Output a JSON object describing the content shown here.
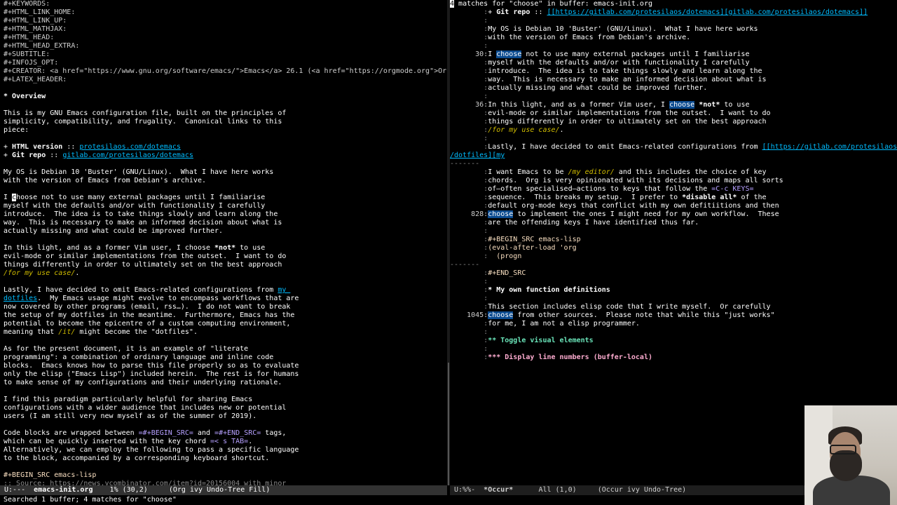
{
  "left": {
    "lines": [
      [
        {
          "t": "#+KEYWORDS:",
          "c": "kw"
        }
      ],
      [
        {
          "t": "#+HTML_LINK_HOME:",
          "c": "kw"
        }
      ],
      [
        {
          "t": "#+HTML_LINK_UP:",
          "c": "kw"
        }
      ],
      [
        {
          "t": "#+HTML_MATHJAX:",
          "c": "kw"
        }
      ],
      [
        {
          "t": "#+HTML_HEAD:",
          "c": "kw"
        }
      ],
      [
        {
          "t": "#+HTML_HEAD_EXTRA:",
          "c": "kw"
        }
      ],
      [
        {
          "t": "#+SUBTITLE:",
          "c": "kw"
        }
      ],
      [
        {
          "t": "#+INFOJS_OPT:",
          "c": "kw"
        }
      ],
      [
        {
          "t": "#+CREATOR: <a href=\"https://www.gnu.org/software/emacs/\">Emacs</a> 26.1 (<a href=\"https://orgmode.org\">Or",
          "c": "kw"
        }
      ],
      [
        {
          "t": "#+LATEX_HEADER:",
          "c": "kw"
        }
      ],
      [],
      [
        {
          "t": "* Overview",
          "c": "heading"
        }
      ],
      [],
      [
        {
          "t": "This is my GNU Emacs configuration file, built on the principles of"
        }
      ],
      [
        {
          "t": "simplicity, compatibility, and frugality.  Canonical links to this"
        }
      ],
      [
        {
          "t": "piece:"
        }
      ],
      [],
      [
        {
          "t": "+ ",
          "c": ""
        },
        {
          "t": "HTML version",
          "c": "heading"
        },
        {
          "t": " :: "
        },
        {
          "t": "protesilaos.com/dotemacs",
          "c": "link"
        }
      ],
      [
        {
          "t": "+ ",
          "c": ""
        },
        {
          "t": "Git repo",
          "c": "heading"
        },
        {
          "t": " :: "
        },
        {
          "t": "gitlab.com/protesilaos/dotemacs",
          "c": "link"
        }
      ],
      [],
      [
        {
          "t": "My OS is Debian 10 'Buster' (GNU/Linux).  What I have here works"
        }
      ],
      [
        {
          "t": "with the version of Emacs from Debian's archive."
        }
      ],
      [],
      [
        {
          "t": "I "
        },
        {
          "t": "c",
          "c": "cursor"
        },
        {
          "t": "hoose not to use many external packages until I familiarise"
        }
      ],
      [
        {
          "t": "myself with the defaults and/or with functionality I carefully"
        }
      ],
      [
        {
          "t": "introduce.  The idea is to take things slowly and learn along the"
        }
      ],
      [
        {
          "t": "way.  This is necessary to make an informed decision about what is"
        }
      ],
      [
        {
          "t": "actually missing and what could be improved further."
        }
      ],
      [],
      [
        {
          "t": "In this light, and as a former Vim user, I choose "
        },
        {
          "t": "*not*",
          "c": "heading"
        },
        {
          "t": " to use"
        }
      ],
      [
        {
          "t": "evil-mode or similar implementations from the outset.  I want to do"
        }
      ],
      [
        {
          "t": "things differently in order to ultimately set on the best approach"
        }
      ],
      [
        {
          "t": "/for my use case/",
          "c": "italic"
        },
        {
          "t": "."
        }
      ],
      [],
      [
        {
          "t": "Lastly, I have decided to omit Emacs-related configurations from "
        },
        {
          "t": "my ",
          "c": "link"
        }
      ],
      [
        {
          "t": "dotfiles",
          "c": "link"
        },
        {
          "t": ".  My Emacs usage might evolve to encompass workflows that are"
        }
      ],
      [
        {
          "t": "now covered by other programs (email, rss…).  I do not want to break"
        }
      ],
      [
        {
          "t": "the setup of my dotfiles in the meantime.  Furthermore, Emacs has the"
        }
      ],
      [
        {
          "t": "potential to become the epicentre of a custom computing environment,"
        }
      ],
      [
        {
          "t": "meaning that "
        },
        {
          "t": "/it/",
          "c": "italic"
        },
        {
          "t": " might become the \"dotfiles\"."
        }
      ],
      [],
      [
        {
          "t": "As for the present document, it is an example of \"literate"
        }
      ],
      [
        {
          "t": "programming\": a combination of ordinary language and inline code"
        }
      ],
      [
        {
          "t": "blocks.  Emacs knows how to parse this file properly so as to evaluate"
        }
      ],
      [
        {
          "t": "only the elisp (\"Emacs Lisp\") included herein.  The rest is for humans"
        }
      ],
      [
        {
          "t": "to make sense of my configurations and their underlying rationale."
        }
      ],
      [],
      [
        {
          "t": "I find this paradigm particularly helpful for sharing Emacs"
        }
      ],
      [
        {
          "t": "configurations with a wider audience that includes new or potential"
        }
      ],
      [
        {
          "t": "users (I am still very new myself as of the summer of 2019)."
        }
      ],
      [],
      [
        {
          "t": "Code blocks are wrapped between "
        },
        {
          "t": "=#+BEGIN_SRC=",
          "c": "verb"
        },
        {
          "t": " and "
        },
        {
          "t": "=#+END_SRC=",
          "c": "verb"
        },
        {
          "t": " tags,"
        }
      ],
      [
        {
          "t": "which can be quickly inserted with the key chord "
        },
        {
          "t": "=< s TAB=",
          "c": "verb"
        },
        {
          "t": "."
        }
      ],
      [
        {
          "t": "Alternatively, we can employ the following to pass a specific language"
        }
      ],
      [
        {
          "t": "to the block, accompanied by a corresponding keyboard shortcut."
        }
      ],
      [],
      [
        {
          "t": "#+BEGIN_SRC emacs-lisp",
          "c": "code"
        }
      ],
      [
        {
          "t": ";; Source: https://news.ycombinator.com/item?id=20156004 with minor",
          "c": "comment"
        }
      ]
    ]
  },
  "right": {
    "lines": [
      [
        {
          "t": "4",
          "c": "cursor"
        },
        {
          "t": " matches for \"choose\" in buffer: emacs-init.org"
        }
      ],
      [
        {
          "t": "        :",
          "c": "sep"
        },
        {
          "t": "+ "
        },
        {
          "t": "Git repo",
          "c": "heading"
        },
        {
          "t": " :: "
        },
        {
          "t": "[[https://gitlab.com/protesilaos/dotemacs][gitlab.com/protesilaos/dotemacs]]",
          "c": "link"
        }
      ],
      [
        {
          "t": "        :",
          "c": "sep"
        }
      ],
      [
        {
          "t": "        :",
          "c": "sep"
        },
        {
          "t": "My OS is Debian 10 'Buster' (GNU/Linux).  What I have here works"
        }
      ],
      [
        {
          "t": "        :",
          "c": "sep"
        },
        {
          "t": "with the version of Emacs from Debian's archive."
        }
      ],
      [
        {
          "t": "        :",
          "c": "sep"
        }
      ],
      [
        {
          "t": "      30:",
          "c": "lnum"
        },
        {
          "t": "I "
        },
        {
          "t": "choose",
          "c": "match"
        },
        {
          "t": " not to use many external packages until I familiarise"
        }
      ],
      [
        {
          "t": "        :",
          "c": "sep"
        },
        {
          "t": "myself with the defaults and/or with functionality I carefully"
        }
      ],
      [
        {
          "t": "        :",
          "c": "sep"
        },
        {
          "t": "introduce.  The idea is to take things slowly and learn along the"
        }
      ],
      [
        {
          "t": "        :",
          "c": "sep"
        },
        {
          "t": "way.  This is necessary to make an informed decision about what is"
        }
      ],
      [
        {
          "t": "        :",
          "c": "sep"
        },
        {
          "t": "actually missing and what could be improved further."
        }
      ],
      [
        {
          "t": "        :",
          "c": "sep"
        }
      ],
      [
        {
          "t": "      36:",
          "c": "lnum"
        },
        {
          "t": "In this light, and as a former Vim user, I "
        },
        {
          "t": "choose",
          "c": "match"
        },
        {
          "t": " "
        },
        {
          "t": "*not*",
          "c": "heading"
        },
        {
          "t": " to use"
        }
      ],
      [
        {
          "t": "        :",
          "c": "sep"
        },
        {
          "t": "evil-mode or similar implementations from the outset.  I want to do"
        }
      ],
      [
        {
          "t": "        :",
          "c": "sep"
        },
        {
          "t": "things differently in order to ultimately set on the best approach"
        }
      ],
      [
        {
          "t": "        :",
          "c": "sep"
        },
        {
          "t": "/for my use case/",
          "c": "italic"
        },
        {
          "t": "."
        }
      ],
      [
        {
          "t": "        :",
          "c": "sep"
        }
      ],
      [
        {
          "t": "        :",
          "c": "sep"
        },
        {
          "t": "Lastly, I have decided to omit Emacs-related configurations from "
        },
        {
          "t": "[[https://gitlab.com/protesilaos",
          "c": "link"
        }
      ],
      [
        {
          "t": "/dotfiles][my",
          "c": "link"
        }
      ],
      [
        {
          "t": "-------",
          "c": "sep"
        }
      ],
      [
        {
          "t": "        :",
          "c": "sep"
        },
        {
          "t": "I want Emacs to be "
        },
        {
          "t": "/my editor/",
          "c": "italic"
        },
        {
          "t": " and this includes the choice of key"
        }
      ],
      [
        {
          "t": "        :",
          "c": "sep"
        },
        {
          "t": "chords.  Org is very opinionated with its decisions and maps all sorts"
        }
      ],
      [
        {
          "t": "        :",
          "c": "sep"
        },
        {
          "t": "of—often specialised—actions to keys that follow the "
        },
        {
          "t": "=C-c KEYS=",
          "c": "verb"
        }
      ],
      [
        {
          "t": "        :",
          "c": "sep"
        },
        {
          "t": "sequence.  This breaks my setup.  I prefer to "
        },
        {
          "t": "*disable all*",
          "c": "heading"
        },
        {
          "t": " of the"
        }
      ],
      [
        {
          "t": "        :",
          "c": "sep"
        },
        {
          "t": "default org-mode keys that conflict with my own defitiitions and then"
        }
      ],
      [
        {
          "t": "     828:",
          "c": "lnum"
        },
        {
          "t": "choose",
          "c": "match"
        },
        {
          "t": " to implement the ones I might need for my own workflow.  These"
        }
      ],
      [
        {
          "t": "        :",
          "c": "sep"
        },
        {
          "t": "are the offending keys I have identified thus far."
        }
      ],
      [
        {
          "t": "        :",
          "c": "sep"
        }
      ],
      [
        {
          "t": "        :",
          "c": "sep"
        },
        {
          "t": "#+BEGIN_SRC emacs-lisp",
          "c": "code"
        }
      ],
      [
        {
          "t": "        :",
          "c": "sep"
        },
        {
          "t": "(eval-after-load 'org",
          "c": "code"
        }
      ],
      [
        {
          "t": "        :",
          "c": "sep"
        },
        {
          "t": "  (progn",
          "c": "code"
        }
      ],
      [
        {
          "t": "-------",
          "c": "sep"
        }
      ],
      [
        {
          "t": "        :",
          "c": "sep"
        },
        {
          "t": "#+END_SRC",
          "c": "code"
        }
      ],
      [
        {
          "t": "        :",
          "c": "sep"
        }
      ],
      [
        {
          "t": "        :",
          "c": "sep"
        },
        {
          "t": "* My own function definitions",
          "c": "heading"
        }
      ],
      [
        {
          "t": "        :",
          "c": "sep"
        }
      ],
      [
        {
          "t": "        :",
          "c": "sep"
        },
        {
          "t": "This section includes elisp code that I write myself.  Or carefully"
        }
      ],
      [
        {
          "t": "    1045:",
          "c": "lnum"
        },
        {
          "t": "choose",
          "c": "match"
        },
        {
          "t": " from other sources.  Please note that while this \"just works\""
        }
      ],
      [
        {
          "t": "        :",
          "c": "sep"
        },
        {
          "t": "for me, I am not a elisp programmer."
        }
      ],
      [
        {
          "t": "        :",
          "c": "sep"
        }
      ],
      [
        {
          "t": "        :",
          "c": "sep"
        },
        {
          "t": "** Toggle visual elements",
          "c": "h2"
        }
      ],
      [
        {
          "t": "        :",
          "c": "sep"
        }
      ],
      [
        {
          "t": "        :",
          "c": "sep"
        },
        {
          "t": "*** Display line numbers (buffer-local)",
          "c": "h3"
        }
      ]
    ]
  },
  "modeline_left": {
    "state": " U:---  ",
    "buffer": "emacs-init.org",
    "position": "    1% (30,2)     ",
    "modes": "(Org ivy Undo-Tree Fill)"
  },
  "modeline_right": {
    "state": " U:%%-  ",
    "buffer": "*Occur*",
    "position": "      All (1,0)     ",
    "modes": "(Occur ivy Undo-Tree)"
  },
  "echo_area": "Searched 1 buffer; 4 matches for \"choose\"",
  "colors": {
    "background": "#000000",
    "match_highlight": "#0a4a8f",
    "link": "#00bcff",
    "italic": "#d0bc00",
    "verbatim": "#b6a0ff",
    "heading2": "#6ae4b9",
    "heading3": "#feacd0"
  }
}
